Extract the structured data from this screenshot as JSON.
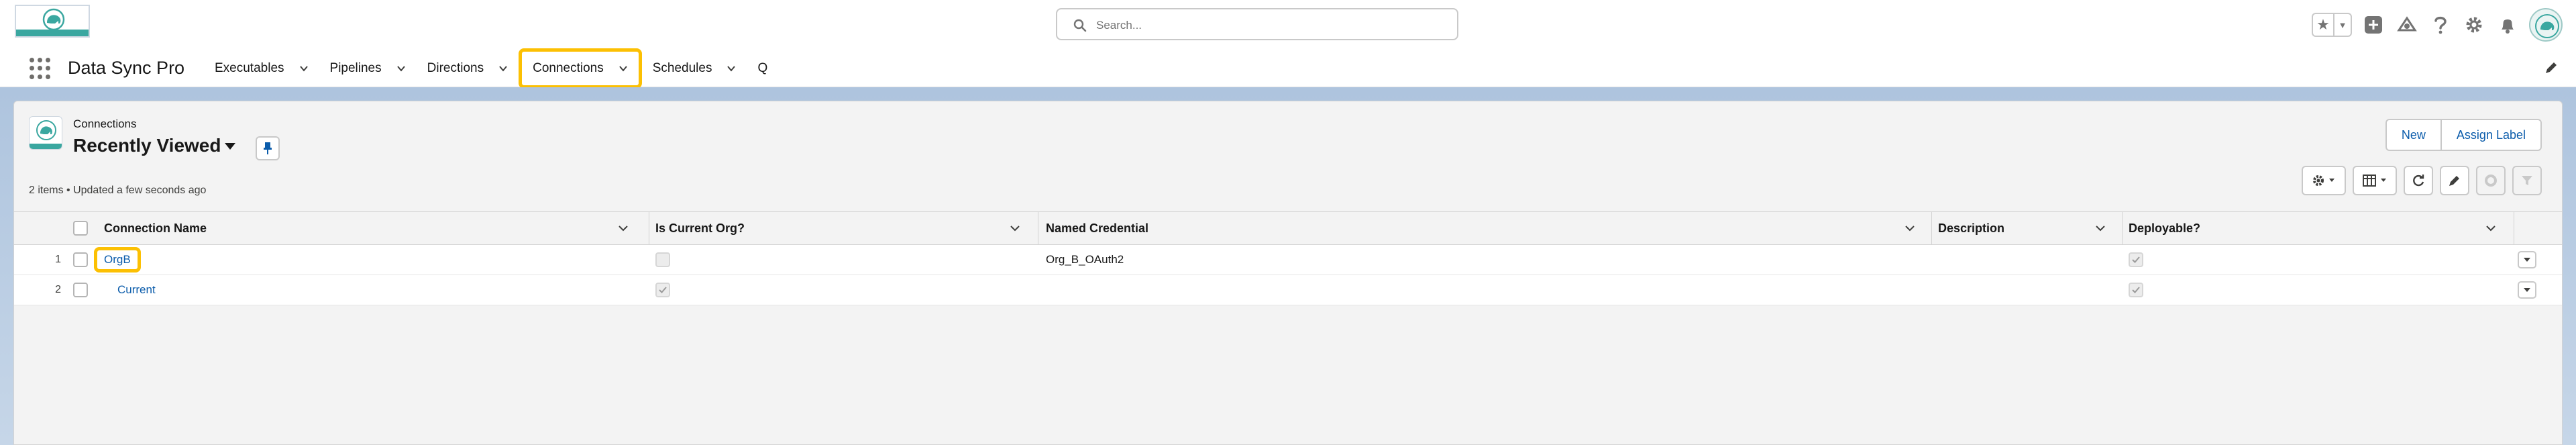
{
  "header": {
    "search_placeholder": "Search...",
    "colors": {
      "highlight": "#fcc003",
      "link": "#0b5cab",
      "brand_teal": "#3aa7a0"
    }
  },
  "nav": {
    "app_name": "Data Sync Pro",
    "items": [
      {
        "label": "Executables",
        "has_menu": true
      },
      {
        "label": "Pipelines",
        "has_menu": true
      },
      {
        "label": "Directions",
        "has_menu": true
      },
      {
        "label": "Connections",
        "has_menu": true,
        "active": true
      },
      {
        "label": "Schedules",
        "has_menu": true
      },
      {
        "label": "Q",
        "has_menu": false
      }
    ]
  },
  "list": {
    "object_label": "Connections",
    "view_name": "Recently Viewed",
    "meta": "2 items • Updated a few seconds ago",
    "buttons": {
      "new": "New",
      "assign_label": "Assign Label"
    }
  },
  "table": {
    "columns": [
      "Connection Name",
      "Is Current Org?",
      "Named Credential",
      "Description",
      "Deployable?"
    ],
    "rows": [
      {
        "num": "1",
        "name": "OrgB",
        "is_current": false,
        "named_credential": "Org_B_OAuth2",
        "description": "",
        "deployable": true
      },
      {
        "num": "2",
        "name": "Current",
        "is_current": true,
        "named_credential": "",
        "description": "",
        "deployable": true
      }
    ]
  }
}
